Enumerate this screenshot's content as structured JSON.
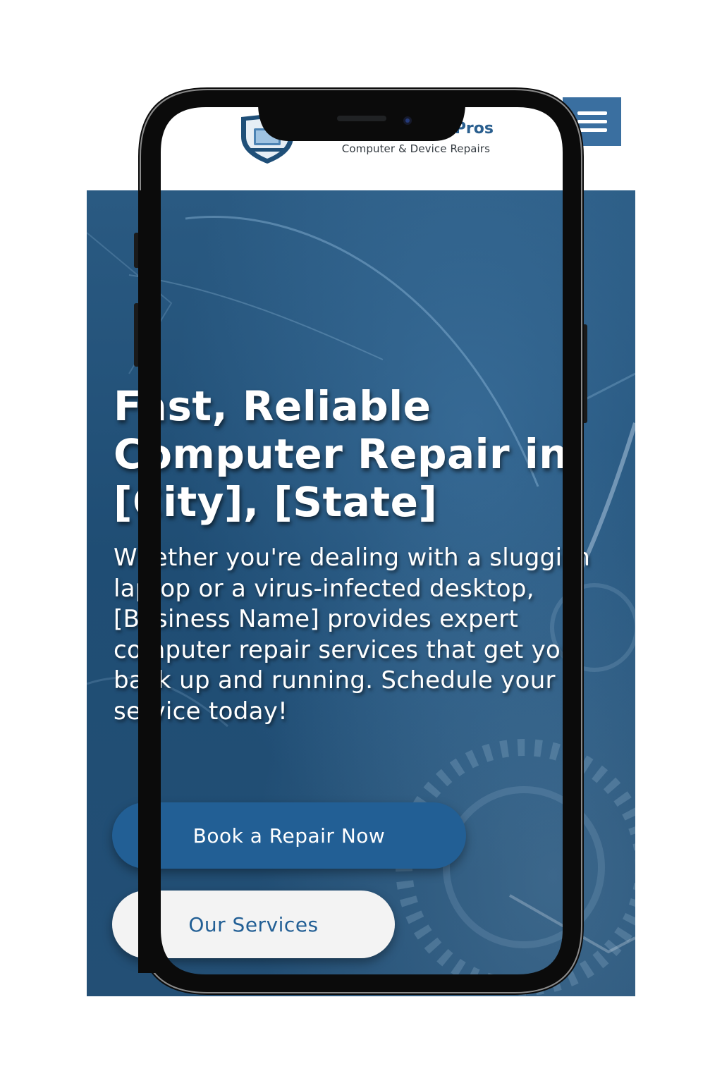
{
  "header": {
    "brand_name": "Pros",
    "tagline": "Computer & Device Repairs",
    "logo_icon": "shield-laptop-icon",
    "menu_icon": "hamburger-menu-icon"
  },
  "hero": {
    "title": "Fast, Reliable Computer Repair in [City], [State]",
    "description": "Whether you're dealing with a sluggish laptop or a virus-infected desktop, [Business Name] provides expert computer repair services that get you back up and running. Schedule your service today!",
    "primary_button": "Book a Repair Now",
    "secondary_button": "Our Services"
  },
  "colors": {
    "brand": "#2a5f8f",
    "menu_button": "#3a6fa0",
    "hero_background": "#1f4d74",
    "primary_button": "#225f95",
    "secondary_button": "#f3f3f3",
    "phone_frame": "#0b0b0b"
  }
}
